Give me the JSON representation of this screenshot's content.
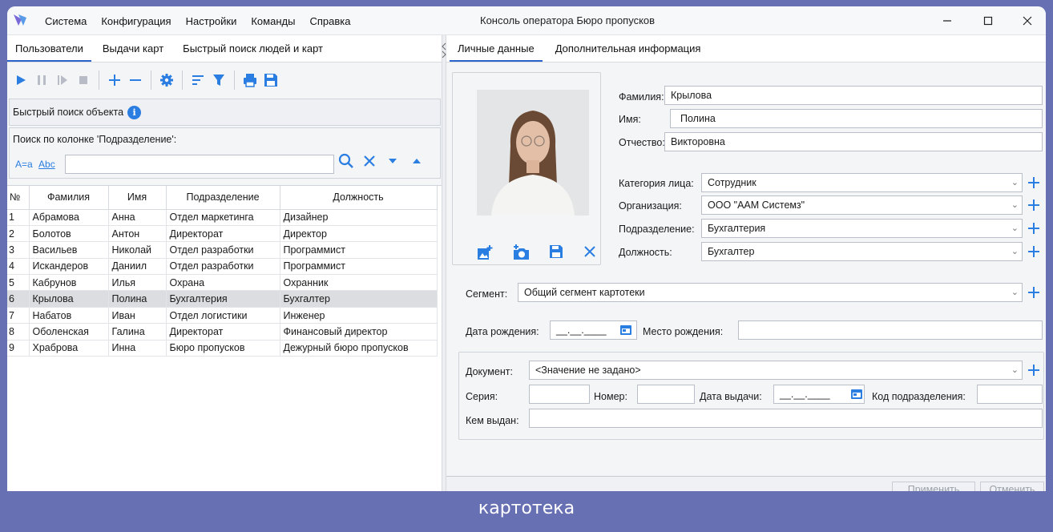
{
  "window": {
    "title": "Консоль оператора Бюро пропусков",
    "menu": [
      "Система",
      "Конфигурация",
      "Настройки",
      "Команды",
      "Справка"
    ]
  },
  "left_tabs": [
    "Пользователи",
    "Выдачи карт",
    "Быстрый поиск людей и карт"
  ],
  "quick_search": {
    "title": "Быстрый поиск объекта",
    "column_label": "Поиск по колонке 'Подразделение':",
    "opt_case": "A=a",
    "opt_word": "Abc",
    "value": ""
  },
  "grid": {
    "columns": [
      "№",
      "Фамилия",
      "Имя",
      "Подразделение",
      "Должность"
    ],
    "rows": [
      [
        "1",
        "Абрамова",
        "Анна",
        "Отдел маркетинга",
        "Дизайнер"
      ],
      [
        "2",
        "Болотов",
        "Антон",
        "Директорат",
        "Директор"
      ],
      [
        "3",
        "Васильев",
        "Николай",
        "Отдел разработки",
        "Программист"
      ],
      [
        "4",
        "Искандеров",
        "Даниил",
        "Отдел разработки",
        "Программист"
      ],
      [
        "5",
        "Кабрунов",
        "Илья",
        "Охрана",
        "Охранник"
      ],
      [
        "6",
        "Крылова",
        "Полина",
        "Бухгалтерия",
        "Бухгалтер"
      ],
      [
        "7",
        "Набатов",
        "Иван",
        "Отдел логистики",
        "Инженер"
      ],
      [
        "8",
        "Оболенская",
        "Галина",
        "Директорат",
        "Финансовый директор"
      ],
      [
        "9",
        "Храброва",
        "Инна",
        "Бюро пропусков",
        "Дежурный бюро пропусков"
      ]
    ],
    "selected_index": 5
  },
  "right_tabs": [
    "Личные данные",
    "Дополнительная информация"
  ],
  "person": {
    "last_name_label": "Фамилия:",
    "last_name": "Крылова",
    "first_name_label": "Имя:",
    "first_name": "Полина",
    "middle_name_label": "Отчество:",
    "middle_name": "Викторовна",
    "category_label": "Категория лица:",
    "category": "Сотрудник",
    "org_label": "Организация:",
    "org": "ООО \"ААМ Системз\"",
    "dept_label": "Подразделение:",
    "dept": "Бухгалтерия",
    "position_label": "Должность:",
    "position": "Бухгалтер",
    "segment_label": "Сегмент:",
    "segment": "Общий сегмент картотеки",
    "birth_date_label": "Дата рождения:",
    "birth_date": "__.__.____",
    "birth_place_label": "Место рождения:",
    "birth_place": ""
  },
  "document": {
    "doc_label": "Документ:",
    "doc": "<Значение не задано>",
    "series_label": "Серия:",
    "series": "",
    "number_label": "Номер:",
    "number": "",
    "issue_date_label": "Дата выдачи:",
    "issue_date": "__.__.____",
    "dept_code_label": "Код подразделения:",
    "dept_code": "",
    "issued_by_label": "Кем выдан:",
    "issued_by": ""
  },
  "buttons": {
    "apply": "Применить",
    "cancel": "Отменить"
  },
  "caption": "картотека",
  "colors": {
    "accent": "#2a7de1",
    "frame": "#6870b4",
    "selected_row": "#dcdde0"
  }
}
